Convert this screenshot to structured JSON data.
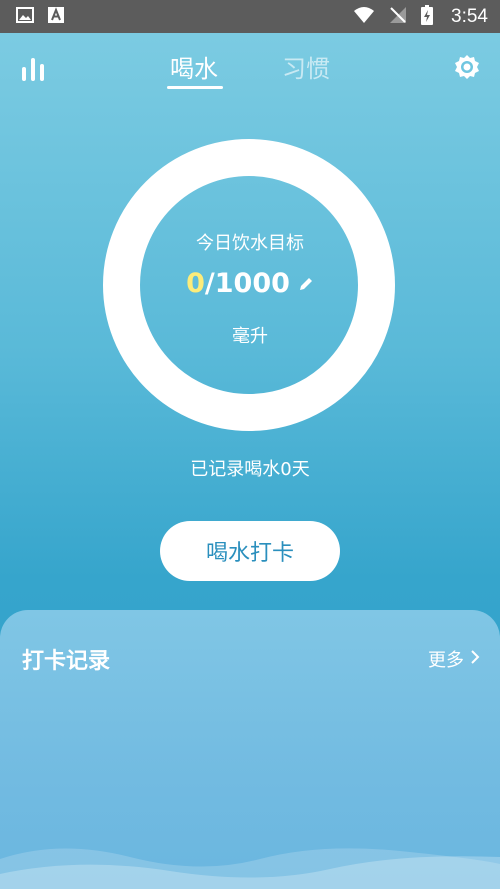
{
  "status_bar": {
    "time": "3:54"
  },
  "tabs": [
    {
      "label": "喝水",
      "active": true
    },
    {
      "label": "习惯",
      "active": false
    }
  ],
  "goal": {
    "label": "今日饮水目标",
    "current": "0",
    "separator": "/",
    "target": "1000",
    "unit": "毫升",
    "progress_fraction": 0
  },
  "days_text": "已记录喝水0天",
  "checkin_button": "喝水打卡",
  "records": {
    "title": "打卡记录",
    "more": "更多"
  },
  "colors": {
    "accent_yellow": "#fcec7a",
    "button_text": "#2a8fbd"
  },
  "icons": {
    "stats": "bar-chart-icon",
    "settings": "gear-icon",
    "edit": "pencil-icon",
    "more": "chevron-right-icon"
  }
}
